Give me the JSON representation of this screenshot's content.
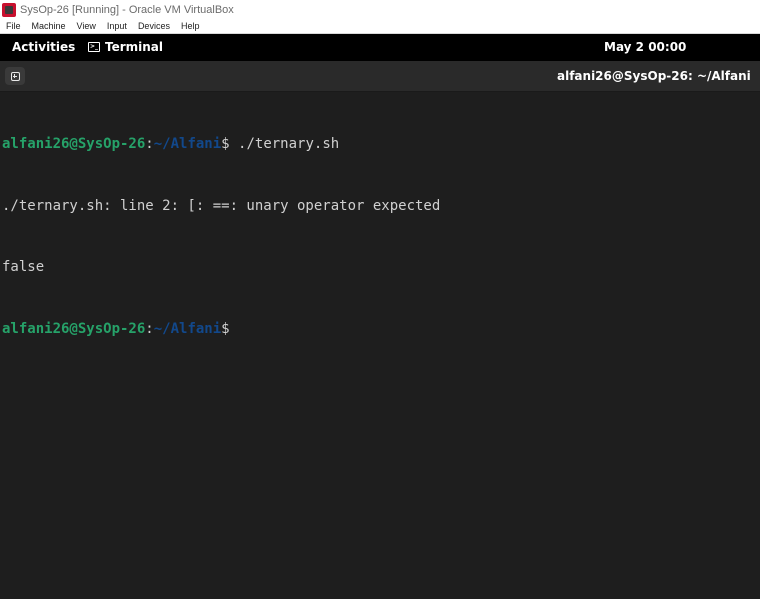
{
  "window": {
    "title": "SysOp-26 [Running] - Oracle VM VirtualBox"
  },
  "vbox_menu": [
    "File",
    "Machine",
    "View",
    "Input",
    "Devices",
    "Help"
  ],
  "top_bar": {
    "activities": "Activities",
    "app_name": "Terminal",
    "clock": "May 2  00:00"
  },
  "terminal_header": {
    "title": "alfani26@SysOp-26: ~/Alfani"
  },
  "terminal": {
    "prompt1": {
      "user": "alfani26@SysOp-26",
      "sep": ":",
      "path": "~/Alfani",
      "dollar": "$",
      "command": " ./ternary.sh"
    },
    "output1": "./ternary.sh: line 2: [: ==: unary operator expected",
    "output2": "false",
    "prompt2": {
      "user": "alfani26@SysOp-26",
      "sep": ":",
      "path": "~/Alfani",
      "dollar": "$",
      "command": ""
    }
  },
  "colors": {
    "prompt_user": "#26a269",
    "prompt_path": "#12488b",
    "terminal_bg": "#1e1e1e"
  },
  "icons": [
    "virtualbox-icon",
    "terminal-icon",
    "new-tab-icon"
  ]
}
